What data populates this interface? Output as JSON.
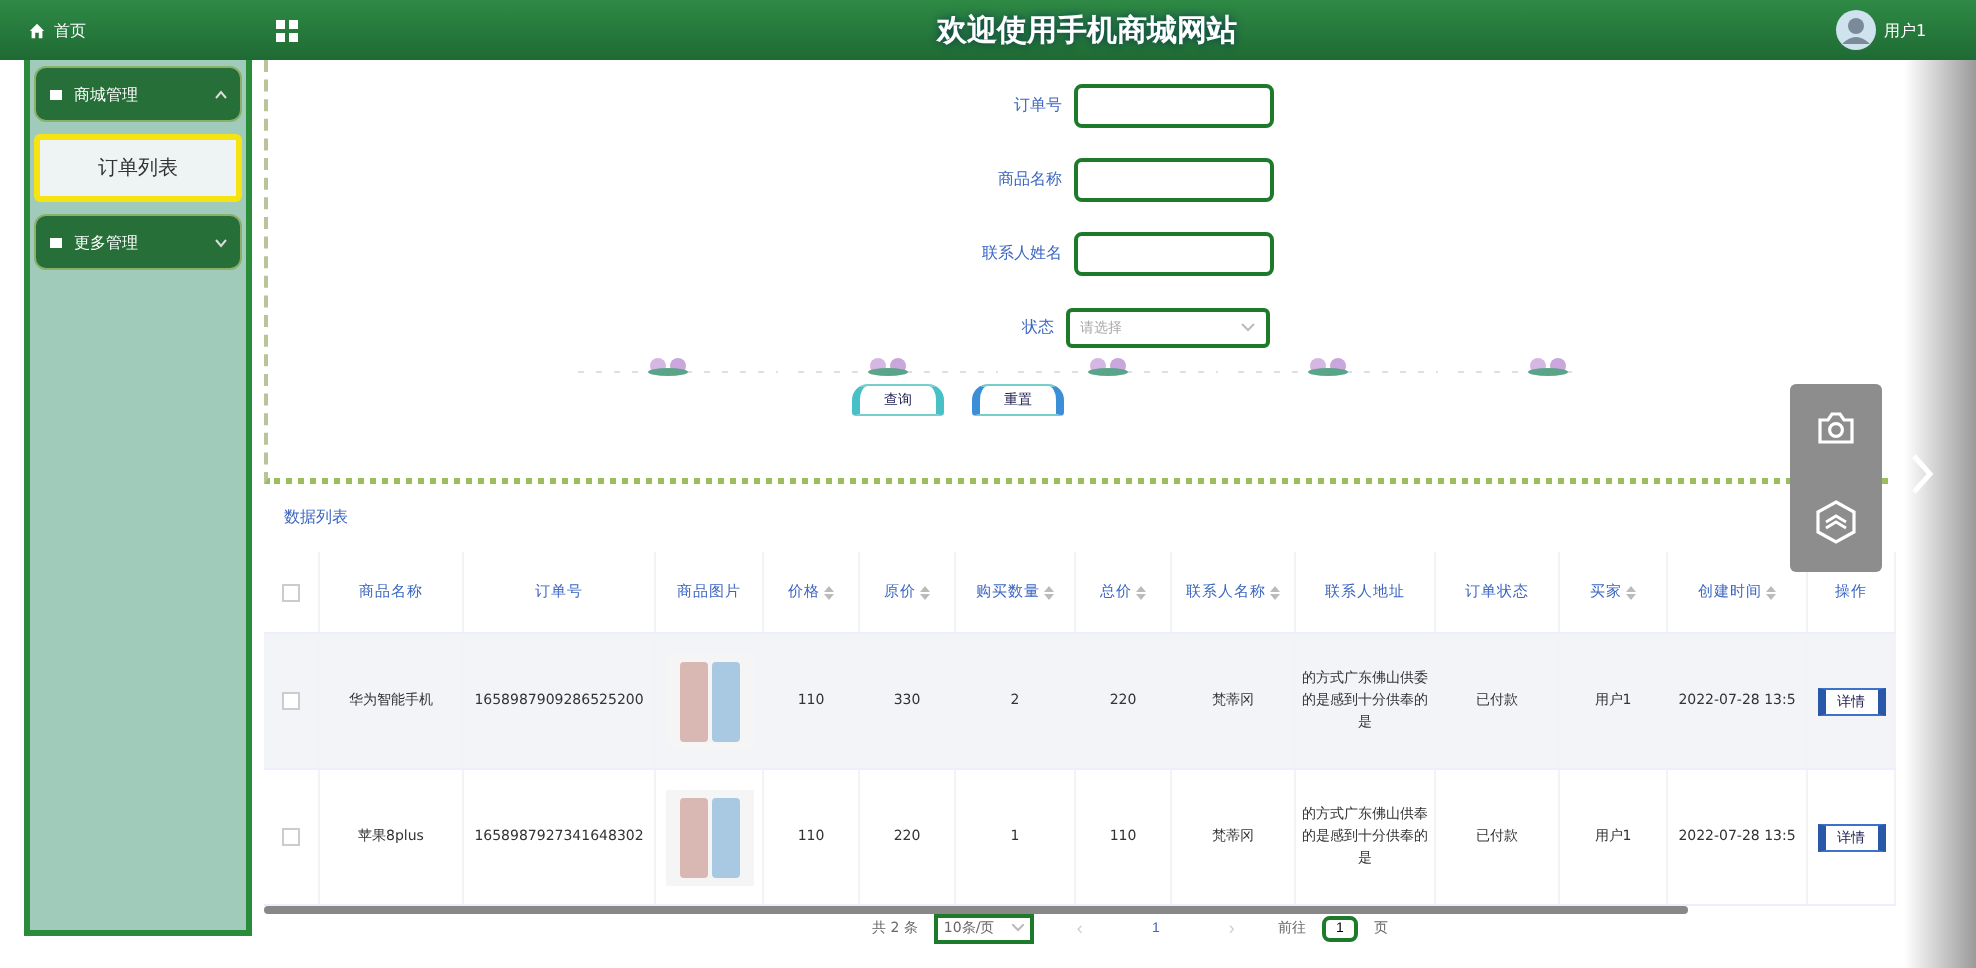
{
  "topbar": {
    "home": "首页",
    "title": "欢迎使用手机商城网站",
    "user": "用户1"
  },
  "sidebar": {
    "items": [
      {
        "label": "商城管理",
        "selected": false,
        "expanded": true
      },
      {
        "label": "订单列表",
        "selected": true
      },
      {
        "label": "更多管理",
        "selected": false,
        "expanded": false
      }
    ]
  },
  "search": {
    "fields": [
      {
        "label": "订单号",
        "kind": "input"
      },
      {
        "label": "商品名称",
        "kind": "input"
      },
      {
        "label": "联系人姓名",
        "kind": "input"
      },
      {
        "label": "状态",
        "kind": "select",
        "placeholder": "请选择"
      }
    ],
    "buttons": [
      "查询",
      "重置"
    ]
  },
  "list_title": "数据列表",
  "table": {
    "select_all_checked": false,
    "columns": [
      {
        "label": "商品名称",
        "sortable": false
      },
      {
        "label": "订单号",
        "sortable": false
      },
      {
        "label": "商品图片",
        "sortable": false
      },
      {
        "label": "价格",
        "sortable": true
      },
      {
        "label": "原价",
        "sortable": true
      },
      {
        "label": "购买数量",
        "sortable": true
      },
      {
        "label": "总价",
        "sortable": true
      },
      {
        "label": "联系人名称",
        "sortable": true
      },
      {
        "label": "联系人地址",
        "sortable": false
      },
      {
        "label": "订单状态",
        "sortable": false
      },
      {
        "label": "买家",
        "sortable": true
      },
      {
        "label": "创建时间",
        "sortable": true
      },
      {
        "label": "操作",
        "sortable": false
      }
    ],
    "rows": [
      {
        "checked": false,
        "cells": [
          "华为智能手机",
          "1658987909286525200",
          "",
          "110",
          "330",
          "2",
          "220",
          "梵蒂冈",
          "的方式广东佛山供委的是感到十分供奉的是",
          "已付款",
          "用户1",
          "2022-07-28 13:5"
        ],
        "action": "详情"
      },
      {
        "checked": false,
        "cells": [
          "苹果8plus",
          "1658987927341648302",
          "",
          "110",
          "220",
          "1",
          "110",
          "梵蒂冈",
          "的方式广东佛山供奉的是感到十分供奉的是",
          "已付款",
          "用户1",
          "2022-07-28 13:5"
        ],
        "action": "详情"
      }
    ]
  },
  "pagination": {
    "total": "共 2 条",
    "page_size": "10条/页",
    "prev": "‹",
    "page": "1",
    "next": "›",
    "goto": "前往",
    "goto_value": "1",
    "goto_unit": "页"
  }
}
